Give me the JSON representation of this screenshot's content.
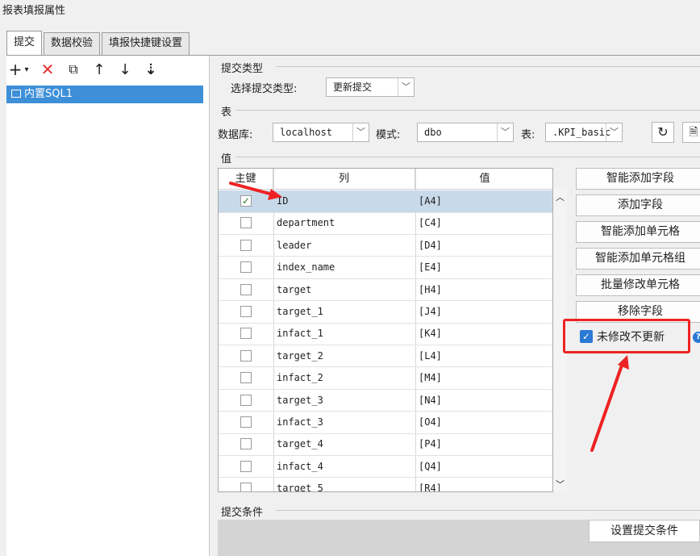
{
  "window_title": "报表填报属性",
  "tabs": [
    "提交",
    "数据校验",
    "填报快捷键设置"
  ],
  "left": {
    "toolbar_icons": [
      "add-icon",
      "dropdown-icon",
      "delete-icon",
      "copy-icon",
      "up-arrow-icon",
      "down-arrow-icon",
      "sort-icon"
    ],
    "items": [
      "内置SQL1"
    ]
  },
  "submit_type": {
    "section_label": "提交类型",
    "label": "选择提交类型:",
    "value": "更新提交"
  },
  "table_section": {
    "section_label": "表",
    "db_label": "数据库:",
    "db_value": "localhost",
    "schema_label": "模式:",
    "schema_value": "dbo",
    "table_label": "表:",
    "table_value": ".KPI_basic"
  },
  "value_section": {
    "section_label": "值",
    "columns": [
      "主键",
      "列",
      "值"
    ],
    "rows": [
      {
        "key": true,
        "col": "ID",
        "val": "[A4]"
      },
      {
        "key": false,
        "col": "department",
        "val": "[C4]"
      },
      {
        "key": false,
        "col": "leader",
        "val": "[D4]"
      },
      {
        "key": false,
        "col": "index_name",
        "val": "[E4]"
      },
      {
        "key": false,
        "col": "target",
        "val": "[H4]"
      },
      {
        "key": false,
        "col": "target_1",
        "val": "[J4]"
      },
      {
        "key": false,
        "col": "infact_1",
        "val": "[K4]"
      },
      {
        "key": false,
        "col": "target_2",
        "val": "[L4]"
      },
      {
        "key": false,
        "col": "infact_2",
        "val": "[M4]"
      },
      {
        "key": false,
        "col": "target_3",
        "val": "[N4]"
      },
      {
        "key": false,
        "col": "infact_3",
        "val": "[O4]"
      },
      {
        "key": false,
        "col": "target_4",
        "val": "[P4]"
      },
      {
        "key": false,
        "col": "infact_4",
        "val": "[Q4]"
      },
      {
        "key": false,
        "col": "target_5",
        "val": "[R4]"
      }
    ]
  },
  "side_buttons": [
    "智能添加字段",
    "添加字段",
    "智能添加单元格",
    "智能添加单元格组",
    "批量修改单元格",
    "移除字段"
  ],
  "no_update_checkbox": {
    "label": "未修改不更新",
    "checked": true
  },
  "submit_condition": {
    "section_label": "提交条件",
    "button": "设置提交条件"
  },
  "colors": {
    "selection": "#3d8fd8",
    "highlight": "#ee2222",
    "accent": "#2b79d5"
  }
}
